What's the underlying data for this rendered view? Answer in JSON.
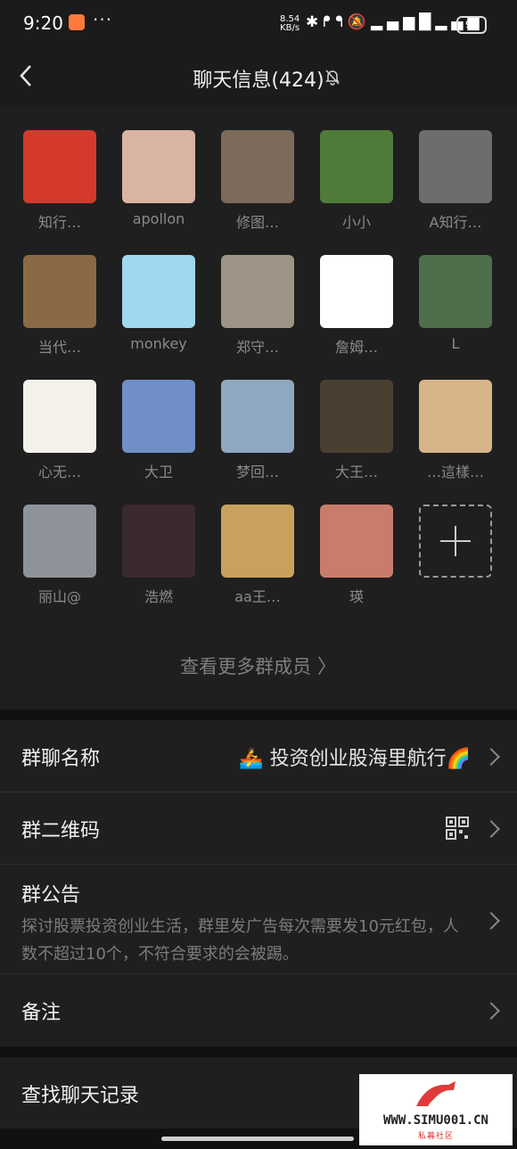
{
  "status_bar": {
    "time": "9:20",
    "more": "···",
    "net_speed": "8.54",
    "net_unit": "KB/s",
    "icons": [
      "bluetooth-icon",
      "earbuds-icon",
      "mute-icon",
      "hd-icon",
      "5g-signal-icon",
      "5g-signal-icon"
    ],
    "battery": "95"
  },
  "header": {
    "title": "聊天信息(424)"
  },
  "members": [
    {
      "name": "知行…",
      "avatar_color": "#d33a2c"
    },
    {
      "name": "apollon",
      "avatar_color": "#d9b3a3"
    },
    {
      "name": "修图…",
      "avatar_color": "#7c6a5a"
    },
    {
      "name": "小小",
      "avatar_color": "#4f7a3a"
    },
    {
      "name": "A知行…",
      "avatar_color": "#6d6d6d"
    },
    {
      "name": "当代…",
      "avatar_color": "#8a6a45"
    },
    {
      "name": "monkey",
      "avatar_color": "#9fd8ef"
    },
    {
      "name": "郑守…",
      "avatar_color": "#9e9486"
    },
    {
      "name": "詹姆…",
      "avatar_color": "#ffffff"
    },
    {
      "name": "L",
      "avatar_color": "#4f6e4b"
    },
    {
      "name": "心无…",
      "avatar_color": "#f4f0ea"
    },
    {
      "name": "大卫",
      "avatar_color": "#6f8fc6"
    },
    {
      "name": "梦回…",
      "avatar_color": "#8fa7bf"
    },
    {
      "name": "大王…",
      "avatar_color": "#4a4031"
    },
    {
      "name": "…這樣…",
      "avatar_color": "#d8b48a"
    },
    {
      "name": "丽山@",
      "avatar_color": "#8d9399"
    },
    {
      "name": "浩燃",
      "avatar_color": "#3a2a2e"
    },
    {
      "name": "aa王…",
      "avatar_color": "#c9a15c"
    },
    {
      "name": "瑛",
      "avatar_color": "#c97c6c"
    }
  ],
  "more_members_label": "查看更多群成员",
  "settings": {
    "group_name_label": "群聊名称",
    "group_name_value": "🚣 投资创业股海里航行🌈",
    "qr_label": "群二维码",
    "notice_label": "群公告",
    "notice_text": "探讨股票投资创业生活，群里发广告每次需要发10元红包，人数不超过10个，不符合要求的会被踢。",
    "remark_label": "备注",
    "search_history_label": "查找聊天记录"
  },
  "watermark": {
    "text": "WWW.SIMU001.CN",
    "sub": "私募社区"
  }
}
